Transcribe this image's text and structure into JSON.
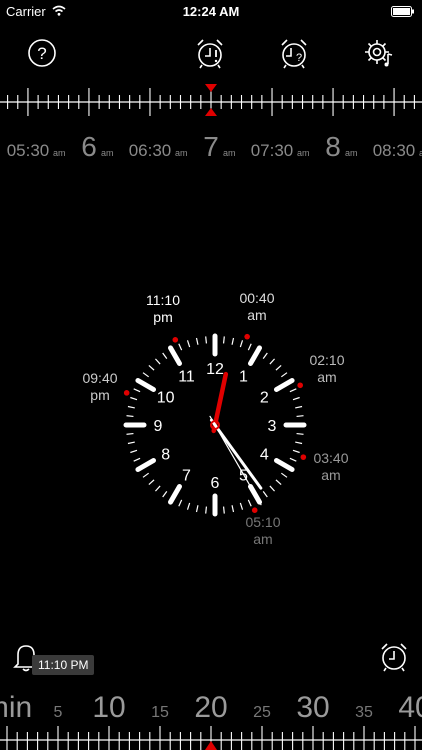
{
  "status_bar": {
    "carrier": "Carrier",
    "time": "12:24 AM"
  },
  "toolbar": {
    "help_icon": "question-circle-icon",
    "alarm_icon": "alarm-clock-exclamation-icon",
    "sleep_alarm_icon": "alarm-clock-question-icon",
    "settings_icon": "gear-music-icon"
  },
  "time_ruler": {
    "labels": [
      {
        "text": "05:30",
        "suffix": "am",
        "major": false
      },
      {
        "text": "6",
        "suffix": "am",
        "major": true
      },
      {
        "text": "06:30",
        "suffix": "am",
        "major": false
      },
      {
        "text": "7",
        "suffix": "am",
        "major": true
      },
      {
        "text": "07:30",
        "suffix": "am",
        "major": false
      },
      {
        "text": "8",
        "suffix": "am",
        "major": true
      },
      {
        "text": "08:30",
        "suffix": "am",
        "major": false
      }
    ],
    "marker_color": "#e00000"
  },
  "clock": {
    "numerals": [
      "12",
      "1",
      "2",
      "3",
      "4",
      "5",
      "6",
      "7",
      "8",
      "9",
      "10",
      "11"
    ],
    "hour_hand_color": "#e00000",
    "cycle_labels": [
      {
        "time": "11:10",
        "period": "pm",
        "shade": "#ffffff"
      },
      {
        "time": "00:40",
        "period": "am",
        "shade": "#dddddd"
      },
      {
        "time": "02:10",
        "period": "am",
        "shade": "#bbbbbb"
      },
      {
        "time": "03:40",
        "period": "am",
        "shade": "#999999"
      },
      {
        "time": "05:10",
        "period": "am",
        "shade": "#777777"
      },
      {
        "time": "09:40",
        "period": "pm",
        "shade": "#cccccc"
      }
    ]
  },
  "bottom": {
    "reminder_icon": "bell-icon",
    "tooltip": "11:10 PM",
    "alarm_icon": "alarm-clock-icon"
  },
  "minute_ruler": {
    "labels": [
      "min",
      "5",
      "10",
      "15",
      "20",
      "25",
      "30",
      "35",
      "40"
    ],
    "marker_color": "#e00000"
  }
}
